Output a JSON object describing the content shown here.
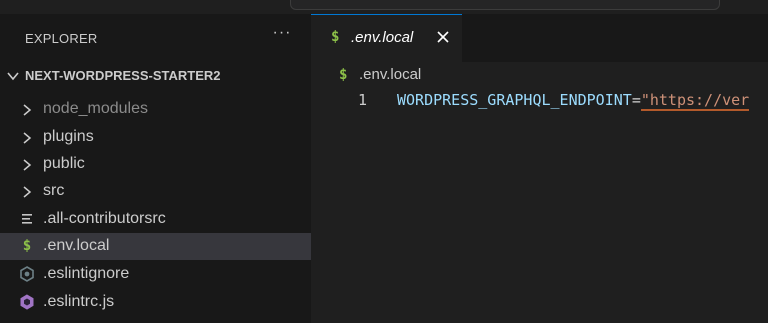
{
  "explorer": {
    "title": "EXPLORER",
    "more_actions": "···",
    "project_name": "NEXT-WORDPRESS-STARTER2",
    "items": [
      {
        "label": "node_modules",
        "type": "folder",
        "dim": true
      },
      {
        "label": "plugins",
        "type": "folder"
      },
      {
        "label": "public",
        "type": "folder"
      },
      {
        "label": "src",
        "type": "folder"
      },
      {
        "label": ".all-contributorsrc",
        "type": "file",
        "icon": "lines-icon"
      },
      {
        "label": ".env.local",
        "type": "file",
        "icon": "dollar-icon",
        "selected": true
      },
      {
        "label": ".eslintignore",
        "type": "file",
        "icon": "eslint-icon"
      },
      {
        "label": ".eslintrc.js",
        "type": "file",
        "icon": "eslint-icon"
      }
    ]
  },
  "editor": {
    "tab_label": ".env.local",
    "tab_icon": "$",
    "breadcrumb_label": ".env.local",
    "line_number": "1",
    "code_key": "WORDPRESS_GRAPHQL_ENDPOINT",
    "code_op": "=",
    "code_value": "\"https://ver"
  },
  "colors": {
    "accent": "#0078d4",
    "env_icon": "#8dc149",
    "eslint_icon": "#a074c4",
    "variable": "#9cdcfe",
    "string": "#ce9178"
  }
}
